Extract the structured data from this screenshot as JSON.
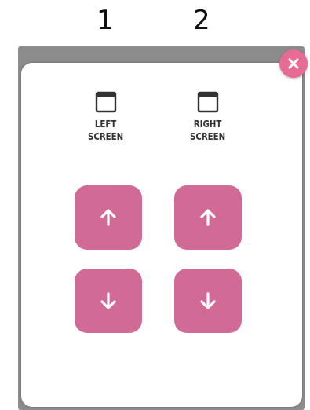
{
  "labels": {
    "column_1": "1",
    "column_2": "2"
  },
  "dialog": {
    "close_icon": "close-icon",
    "accent_color": "#d16b96",
    "close_color": "#e86b95",
    "left_screen": {
      "line1": "LEFT",
      "line2": "SCREEN",
      "icon": "window-icon",
      "up_icon": "arrow-up-icon",
      "down_icon": "arrow-down-icon"
    },
    "right_screen": {
      "line1": "RIGHT",
      "line2": "SCREEN",
      "icon": "window-icon",
      "up_icon": "arrow-up-icon",
      "down_icon": "arrow-down-icon"
    }
  }
}
